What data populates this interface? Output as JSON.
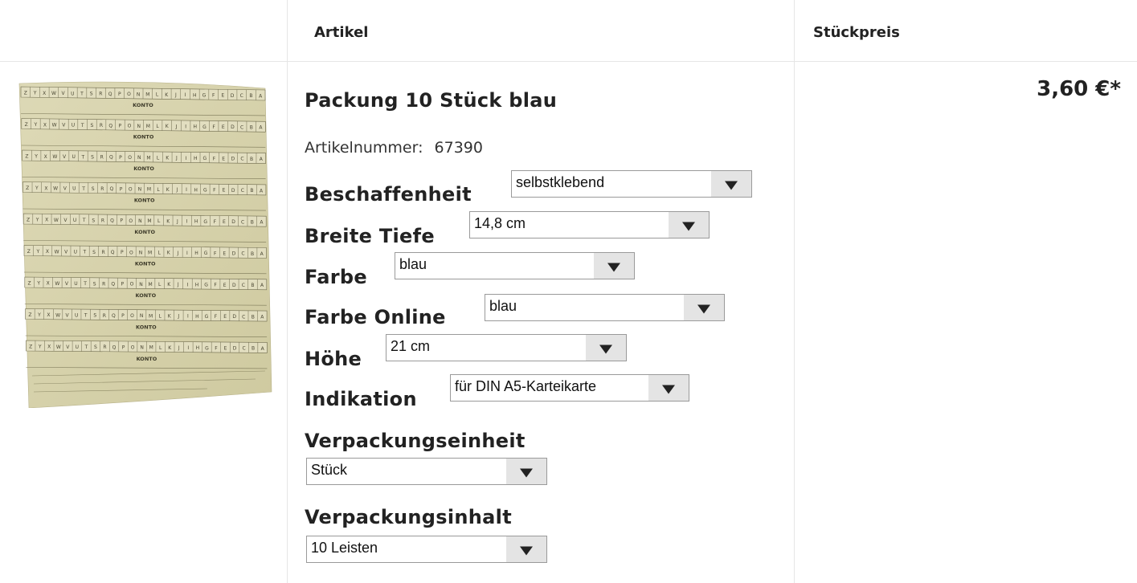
{
  "table": {
    "headers": {
      "artikel": "Artikel",
      "stueckpreis": "Stückpreis"
    }
  },
  "product": {
    "title": "Packung 10 Stück blau",
    "article_number_label": "Artikelnummer:",
    "article_number": "67390",
    "price": "3,60 €*",
    "image": {
      "row_label": "KONTO",
      "row_letters": [
        "A",
        "B",
        "C",
        "D",
        "E",
        "F",
        "G",
        "H",
        "I",
        "J",
        "K",
        "L",
        "M",
        "N",
        "O",
        "P",
        "Q",
        "R",
        "S",
        "T",
        "U",
        "V",
        "W",
        "X",
        "Y",
        "Z"
      ],
      "rows": 9,
      "paper_color": "#d6d2ab"
    }
  },
  "options": [
    {
      "label": "Beschaffenheit",
      "value": "selbstklebend"
    },
    {
      "label": "Breite Tiefe",
      "value": "14,8 cm"
    },
    {
      "label": "Farbe",
      "value": "blau"
    },
    {
      "label": "Farbe Online",
      "value": "blau"
    },
    {
      "label": "Höhe",
      "value": "21 cm"
    },
    {
      "label": "Indikation",
      "value": "für DIN A5-Karteikarte"
    },
    {
      "label": "Verpackungseinheit",
      "value": "Stück"
    },
    {
      "label": "Verpackungsinhalt",
      "value": "10 Leisten"
    }
  ]
}
